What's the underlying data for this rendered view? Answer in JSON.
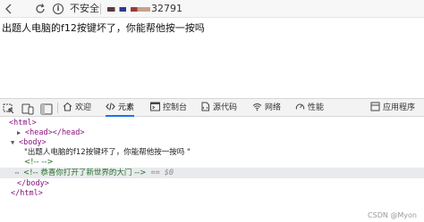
{
  "browser": {
    "security_label": "不安全",
    "url_visible": "32791",
    "security_icon": "info-icon"
  },
  "page": {
    "text": "出题人电脑的f12按键坏了，你能帮他按一按吗"
  },
  "devtools": {
    "tabs": [
      {
        "label": "欢迎",
        "icon": "home-icon",
        "active": false
      },
      {
        "label": "元素",
        "icon": "code-icon",
        "active": true
      },
      {
        "label": "控制台",
        "icon": "console-icon",
        "active": false
      },
      {
        "label": "源代码",
        "icon": "sources-icon",
        "active": false
      },
      {
        "label": "网络",
        "icon": "wifi-icon",
        "active": false
      },
      {
        "label": "性能",
        "icon": "performance-icon",
        "active": false
      },
      {
        "label": "应用程序",
        "icon": "application-icon",
        "active": false
      }
    ],
    "dom": {
      "html_open": "<html>",
      "head": "<head></head>",
      "body_open": "<body>",
      "text_node": "\"出题人电脑的f12按键坏了，你能帮他按一按吗 \"",
      "comment1": "<!--  -->",
      "comment2": "<!-- 恭喜你打开了新世界的大门 -->",
      "dollar": "== $0",
      "body_close": "</body>",
      "html_close": "</html>"
    }
  },
  "watermark": "CSDN @Myon",
  "colors": {
    "tag": "#881280",
    "comment": "#236e25",
    "active_tab_underline": "#1a73e8"
  }
}
